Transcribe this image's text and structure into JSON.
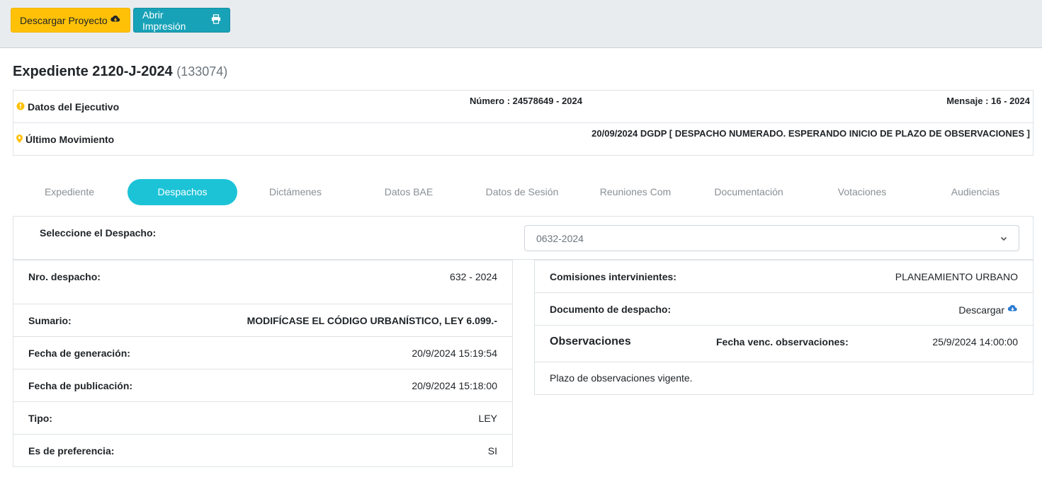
{
  "toolbar": {
    "download_label": "Descargar Proyecto",
    "print_label": "Abrir Impresión",
    "download_color": "#ffc107",
    "print_color": "#17a2b8"
  },
  "header": {
    "title": "Expediente 2120-J-2024",
    "subtitle": "(133074)"
  },
  "info": {
    "ejecutivo_label": "Datos del Ejecutivo",
    "numero": "Número : 24578649 - 2024",
    "mensaje": "Mensaje : 16 - 2024",
    "movimiento_label": "Último Movimiento",
    "movimiento_value": "20/09/2024 DGDP [ DESPACHO NUMERADO. ESPERANDO INICIO DE PLAZO DE OBSERVACIONES ]"
  },
  "tabs": [
    {
      "label": "Expediente"
    },
    {
      "label": "Despachos"
    },
    {
      "label": "Dictámenes"
    },
    {
      "label": "Datos BAE"
    },
    {
      "label": "Datos de Sesión"
    },
    {
      "label": "Reuniones Com"
    },
    {
      "label": "Documentación"
    },
    {
      "label": "Votaciones"
    },
    {
      "label": "Audiencias"
    }
  ],
  "active_tab": "Despachos",
  "selector": {
    "label": "Seleccione el Despacho:",
    "value": "0632-2024"
  },
  "despacho": {
    "nro_label": "Nro. despacho:",
    "nro_value": "632 - 2024",
    "sumario_label": "Sumario:",
    "sumario_value": "MODIFÍCASE EL CÓDIGO URBANÍSTICO, LEY 6.099.-",
    "generacion_label": "Fecha de generación:",
    "generacion_value": "20/9/2024 15:19:54",
    "publicacion_label": "Fecha de publicación:",
    "publicacion_value": "20/9/2024 15:18:00",
    "tipo_label": "Tipo:",
    "tipo_value": "LEY",
    "preferencia_label": "Es de preferencia:",
    "preferencia_value": "SI"
  },
  "comisiones": {
    "label": "Comisiones intervinientes:",
    "value": "PLANEAMIENTO URBANO",
    "documento_label": "Documento de despacho:",
    "documento_link": "Descargar",
    "obs_title": "Observaciones",
    "venc_label": "Fecha venc. observaciones:",
    "venc_value": "25/9/2024 14:00:00",
    "obs_text": "Plazo de observaciones vigente."
  }
}
